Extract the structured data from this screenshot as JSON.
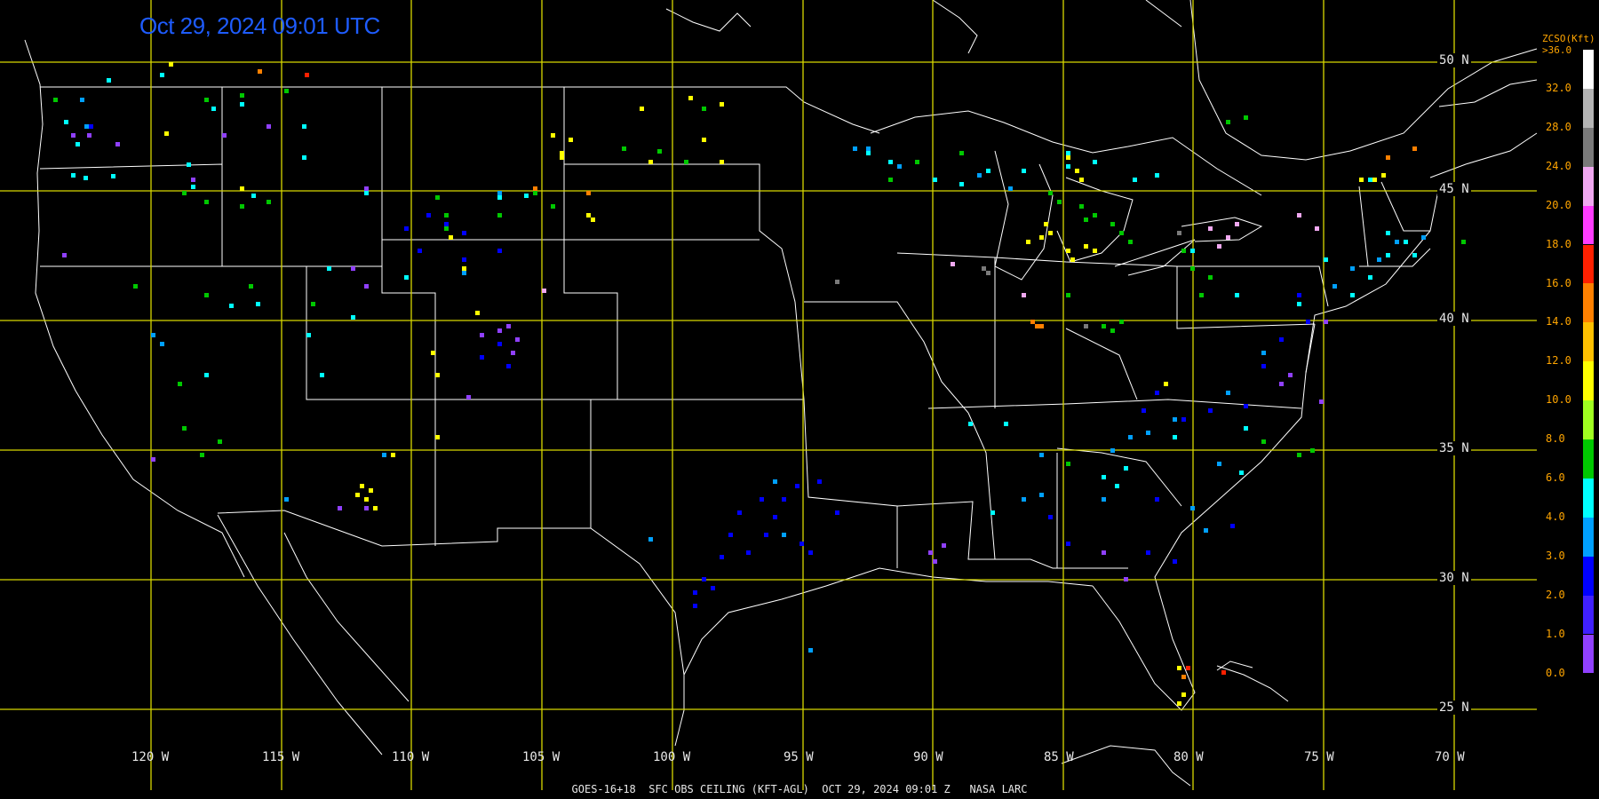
{
  "timestamp": "Oct 29, 2024 09:01 UTC",
  "footer": "GOES-16+18  SFC OBS CEILING (KFT-AGL)  OCT 29, 2024 09:01 Z   NASA LARC",
  "legend": {
    "title_line1": "ZCSO(Kft)",
    "title_line2": ">36.0",
    "labels": [
      "32.0",
      "28.0",
      "24.0",
      "20.0",
      "18.0",
      "16.0",
      "14.0",
      "12.0",
      "10.0",
      "8.0",
      "6.0",
      "4.0",
      "3.0",
      "2.0",
      "1.0",
      "0.0"
    ],
    "colors": [
      "#ffffff",
      "#b4b4b4",
      "#7a7a7a",
      "#f0a8f0",
      "#ff3cff",
      "#ff2000",
      "#ff8000",
      "#ffc000",
      "#ffff00",
      "#a0ff20",
      "#00c800",
      "#00ffff",
      "#00a0ff",
      "#0000ff",
      "#4020ff",
      "#9040ff"
    ]
  },
  "grid": {
    "latitudes": [
      "50 N",
      "45 N",
      "40 N",
      "35 N",
      "30 N",
      "25 N"
    ],
    "longitudes": [
      "120 W",
      "115 W",
      "110 W",
      "105 W",
      "100 W",
      "95 W",
      "90 W",
      "85 W",
      "80 W",
      "75 W",
      "70 W"
    ]
  },
  "colors": {
    "background": "#000000",
    "grid_lines": "#d8d800",
    "boundaries": "#ffffff",
    "timestamp": "#1e5cff",
    "legend_text": "#ffa500"
  }
}
